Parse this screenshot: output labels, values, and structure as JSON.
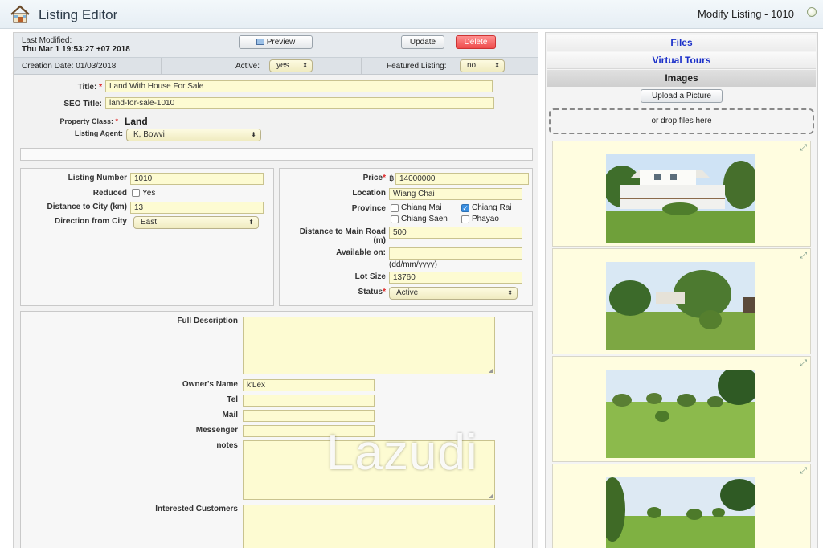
{
  "header": {
    "app_title": "Listing Editor",
    "modify_title": "Modify Listing - 1010"
  },
  "meta": {
    "last_modified_label": "Last Modified:",
    "last_modified_value": "Thu Mar 1 19:53:27 +07 2018",
    "creation_date": "Creation Date: 01/03/2018",
    "active_label": "Active:",
    "active_value": "yes",
    "featured_label": "Featured Listing:",
    "featured_value": "no"
  },
  "toolbar": {
    "preview_label": "Preview",
    "update_label": "Update",
    "delete_label": "Delete"
  },
  "basic": {
    "title_label": "Title:",
    "title_value": "Land With House For Sale",
    "seo_label": "SEO Title:",
    "seo_value": "land-for-sale-1010",
    "property_class_label": "Property Class:",
    "property_class_value": "Land",
    "agent_label": "Listing Agent:",
    "agent_value": "K, Bowvi"
  },
  "details_left": {
    "listing_number_label": "Listing Number",
    "listing_number_value": "1010",
    "reduced_label": "Reduced",
    "reduced_option": "Yes",
    "distance_city_label": "Distance to City (km)",
    "distance_city_value": "13",
    "direction_label": "Direction from City",
    "direction_value": "East"
  },
  "details_right": {
    "price_label": "Price",
    "price_currency": "฿",
    "price_value": "14000000",
    "location_label": "Location",
    "location_value": "Wiang Chai",
    "province_label": "Province",
    "provinces": [
      {
        "name": "Chiang Mai",
        "checked": false
      },
      {
        "name": "Chiang Rai",
        "checked": true
      },
      {
        "name": "Chiang Saen",
        "checked": false
      },
      {
        "name": "Phayao",
        "checked": false
      }
    ],
    "main_road_label_1": "Distance to Main Road",
    "main_road_label_2": "(m)",
    "main_road_value": "500",
    "available_label": "Available on:",
    "available_value": "",
    "available_hint": "(dd/mm/yyyy)",
    "lot_size_label": "Lot Size",
    "lot_size_value": "13760",
    "status_label": "Status",
    "status_value": "Active"
  },
  "description": {
    "full_description_label": "Full Description",
    "owner_label": "Owner's Name",
    "owner_value": "k'Lex",
    "tel_label": "Tel",
    "mail_label": "Mail",
    "messenger_label": "Messenger",
    "notes_label": "notes",
    "interested_label": "Interested Customers"
  },
  "media": {
    "tabs": [
      "Files",
      "Virtual Tours",
      "Images"
    ],
    "upload_label": "Upload a Picture",
    "drop_label": "or drop files here"
  },
  "watermark": "Lazudi"
}
